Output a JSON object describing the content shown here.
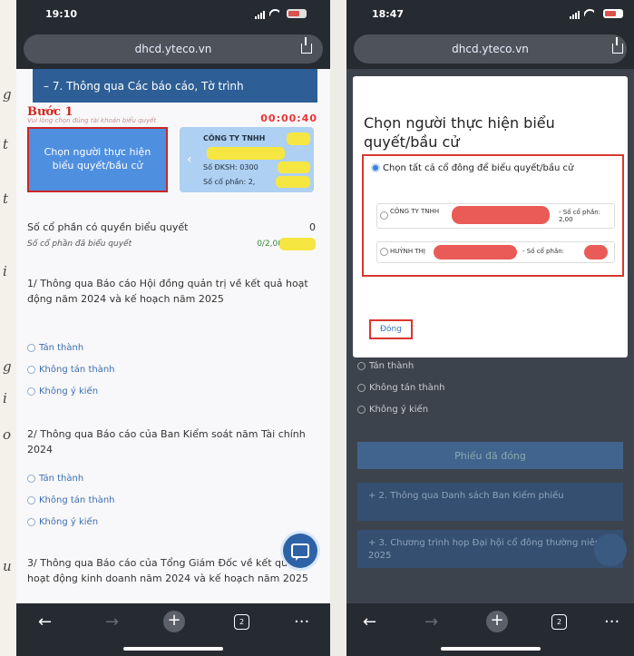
{
  "margin_marks": [
    "g",
    "t",
    "t",
    "i",
    "g",
    "i",
    "o",
    "u"
  ],
  "phone1": {
    "status_time": "19:10",
    "url": "dhcd.yteco.vn",
    "section_header": "– 7. Thông qua Các báo cáo, Tờ trình",
    "step_label": "Bước 1",
    "hint": "Vui lòng chọn đúng tài khoản biểu quyết",
    "timer": "00:00:40",
    "choose_button": "Chọn người thực hiện biểu quyết/bầu cử",
    "company": {
      "name": "CÔNG TY TNHH",
      "dkh": "Số ĐKSH: 0300",
      "shares": "Số cổ phần: 2,"
    },
    "vote_rights_label": "Số cổ phần có quyền biểu quyết",
    "vote_rights_value": "0",
    "voted_label": "Số cổ phần đã biểu quyết",
    "voted_value": "0/2,00",
    "questions": [
      {
        "text": "1/ Thông qua Báo cáo Hội đồng quản trị về kết quả hoạt động năm 2024 và kế hoạch năm 2025",
        "options": [
          "Tán thành",
          "Không tán thành",
          "Không ý kiến"
        ]
      },
      {
        "text": "2/ Thông qua Báo cáo của Ban Kiểm soát năm Tài chính 2024",
        "options": [
          "Tán thành",
          "Không tán thành",
          "Không ý kiến"
        ]
      },
      {
        "text": "3/ Thông qua Báo cáo của Tổng Giám Đốc về kết quả hoạt động kinh doanh năm 2024 và kế hoạch năm 2025"
      }
    ],
    "toolbar": {
      "back": "←",
      "forward": "→",
      "new_tab": "+",
      "tabs_count": "2",
      "more": "···"
    }
  },
  "phone2": {
    "status_time": "18:47",
    "url": "dhcd.yteco.vn",
    "modal": {
      "title": "Chọn người thực hiện biểu quyết/bầu cử",
      "select_all": "Chọn tất cả cổ đông để biểu quyết/bầu cử",
      "shareholders": [
        {
          "name": "CÔNG TY TNHH",
          "shares_label": "- Số cổ phần: 2,00"
        },
        {
          "name": "HUỲNH THỊ",
          "shares_label": "- Số cổ phần:"
        }
      ],
      "close_button": "Đóng"
    },
    "background": {
      "options": [
        "Tán thành",
        "Không tán thành",
        "Không ý kiến"
      ],
      "vote_button": "Phiếu đã đóng",
      "sections": [
        "+ 2. Thông qua Danh sách Ban Kiểm phiếu",
        "+ 3. Chương trình họp Đại hội cổ đông thường niên 2025"
      ]
    },
    "toolbar": {
      "back": "←",
      "forward": "→",
      "new_tab": "+",
      "tabs_count": "2",
      "more": "···"
    }
  }
}
